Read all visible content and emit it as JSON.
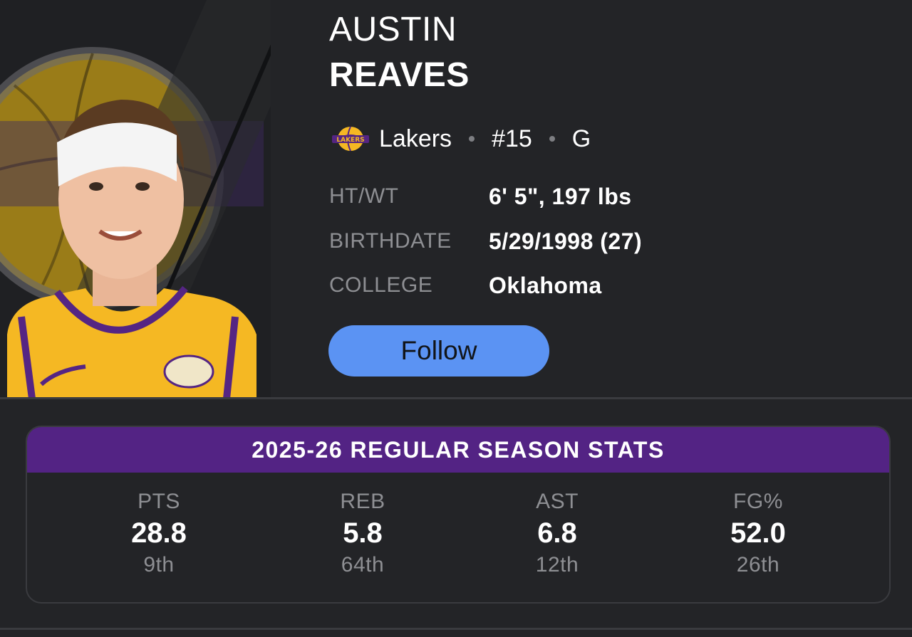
{
  "player": {
    "first_name": "AUSTIN",
    "last_name": "REAVES",
    "team": "Lakers",
    "number": "#15",
    "position": "G",
    "team_logo_icon": "lakers-logo-icon",
    "team_colors": {
      "gold": "#f5b823",
      "purple": "#552583"
    }
  },
  "details": [
    {
      "label": "HT/WT",
      "value": "6' 5\", 197 lbs"
    },
    {
      "label": "BIRTHDATE",
      "value": "5/29/1998 (27)"
    },
    {
      "label": "COLLEGE",
      "value": "Oklahoma"
    }
  ],
  "follow_label": "Follow",
  "stats": {
    "title": "2025-26 REGULAR SEASON STATS",
    "items": [
      {
        "label": "PTS",
        "value": "28.8",
        "rank": "9th"
      },
      {
        "label": "REB",
        "value": "5.8",
        "rank": "64th"
      },
      {
        "label": "AST",
        "value": "6.8",
        "rank": "12th"
      },
      {
        "label": "FG%",
        "value": "52.0",
        "rank": "26th"
      }
    ]
  },
  "colors": {
    "background": "#232427",
    "accent_button": "#5b93f3",
    "stats_header": "#532384",
    "muted_text": "#8e8f93"
  }
}
